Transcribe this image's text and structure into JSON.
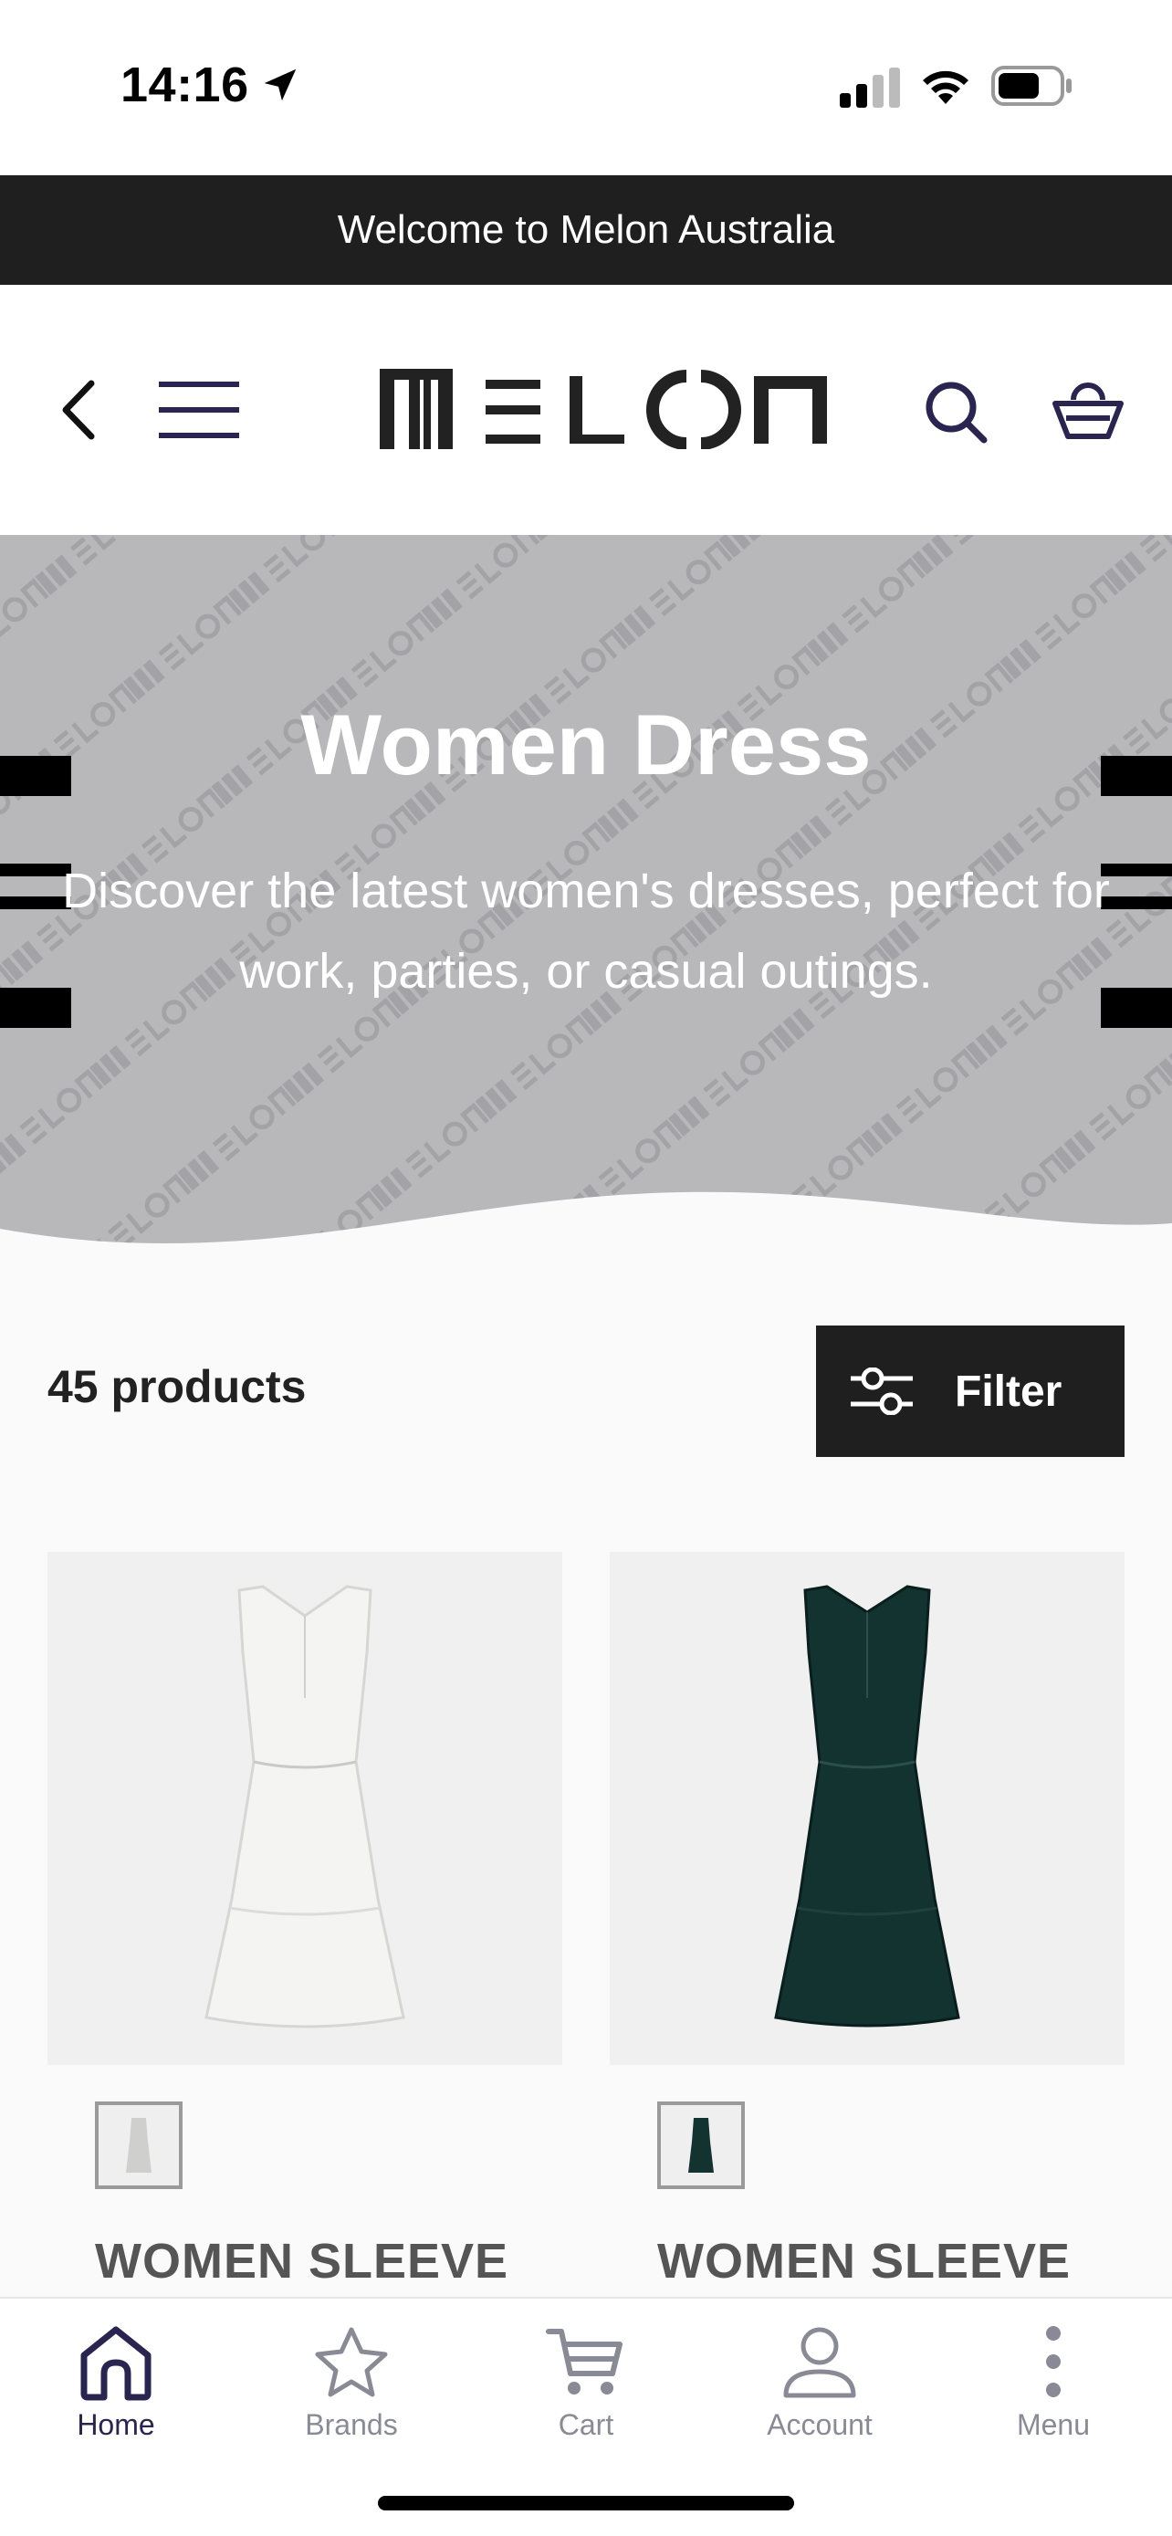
{
  "status_bar": {
    "time": "14:16"
  },
  "announcement": {
    "text": "Welcome to Melon Australia"
  },
  "header": {
    "logo_text": "MELON"
  },
  "hero": {
    "title": "Women Dress",
    "description": "Discover the latest women's dresses, perfect for work, parties, or casual outings."
  },
  "listing": {
    "count_text": "45 products",
    "filter_label": "Filter"
  },
  "products": [
    {
      "title": "WOMEN SLEEVE",
      "color": "#f4f4f2"
    },
    {
      "title": "WOMEN SLEEVE",
      "color": "#123330"
    }
  ],
  "tabbar": {
    "tabs": [
      {
        "label": "Home",
        "icon": "home-icon",
        "active": true
      },
      {
        "label": "Brands",
        "icon": "star-icon",
        "active": false
      },
      {
        "label": "Cart",
        "icon": "cart-icon",
        "active": false
      },
      {
        "label": "Account",
        "icon": "account-icon",
        "active": false
      },
      {
        "label": "Menu",
        "icon": "menu-dots-icon",
        "active": false
      }
    ]
  },
  "colors": {
    "accent": "#2a2450",
    "dark": "#1f1f1f",
    "hero_bg": "#b8b8bb",
    "inactive": "#8a8a96"
  }
}
